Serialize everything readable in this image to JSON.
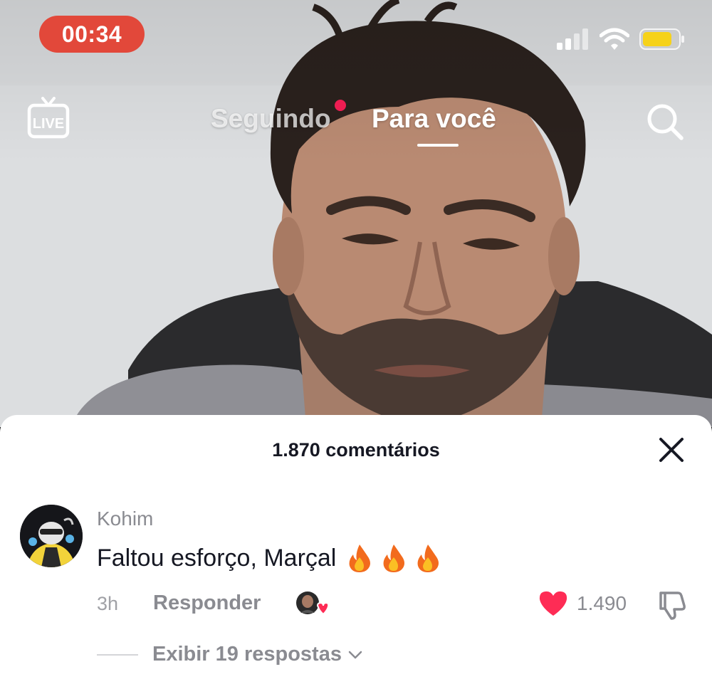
{
  "status_bar": {
    "recording_timer": "00:34",
    "icons": [
      "signal-icon",
      "wifi-icon",
      "battery-icon"
    ],
    "timer_color": "#e2483a",
    "battery_color": "#f6d21a"
  },
  "top_nav": {
    "live_icon": "live-icon",
    "tabs": [
      {
        "label": "Seguindo",
        "active": false,
        "has_notification_dot": true
      },
      {
        "label": "Para você",
        "active": true
      }
    ],
    "search_icon": "search-icon"
  },
  "comments_sheet": {
    "title": "1.870 comentários",
    "close_icon": "close-icon",
    "comment": {
      "username": "Kohim",
      "text": "Faltou esforço, Marçal",
      "emoji": [
        "🔥",
        "🔥",
        "🔥"
      ],
      "time": "3h",
      "reply_label": "Responder",
      "creator_liked": true,
      "likes": "1.490",
      "liked": true,
      "like_color": "#fe2c55",
      "view_replies_label": "Exibir 19 respostas"
    }
  }
}
